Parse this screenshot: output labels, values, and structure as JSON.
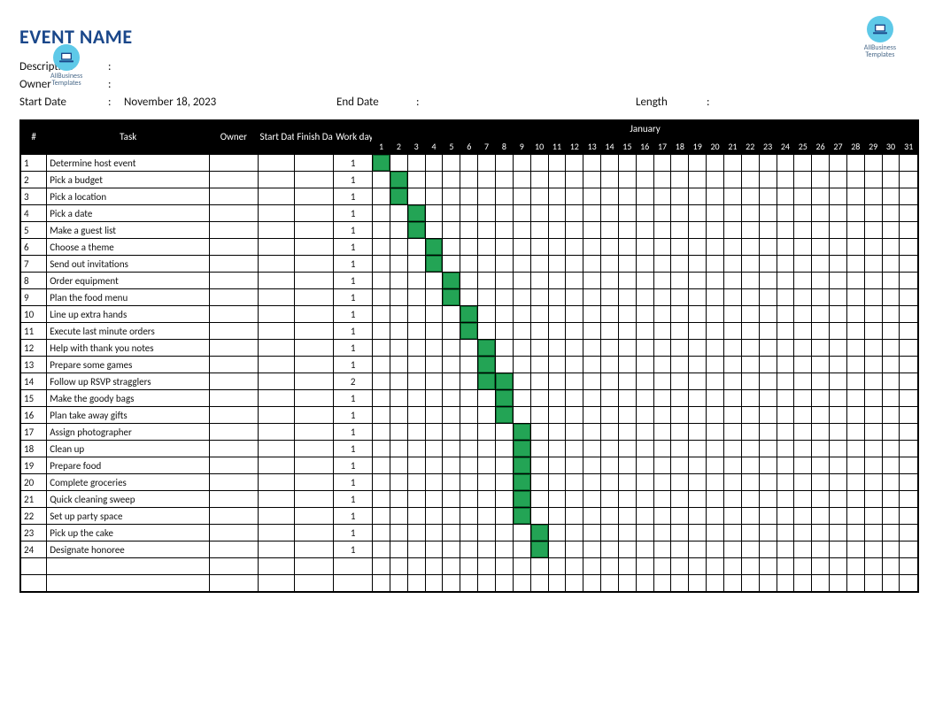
{
  "title": "EVENT NAME",
  "logo_text1": "AllBusiness",
  "logo_text2": "Templates",
  "meta": {
    "description_label": "Description",
    "description_value": "",
    "owner_label": "Owner",
    "owner_value": "",
    "startdate_label": "Start Date",
    "startdate_value": "November 18, 2023",
    "enddate_label": "End Date",
    "enddate_value": "",
    "length_label": "Length",
    "length_value": ""
  },
  "headers": {
    "num": "#",
    "task": "Task",
    "owner": "Owner",
    "start": "Start Date",
    "finish": "Finish Date",
    "work": "Work days",
    "month": "January"
  },
  "days": [
    1,
    2,
    3,
    4,
    5,
    6,
    7,
    8,
    9,
    10,
    11,
    12,
    13,
    14,
    15,
    16,
    17,
    18,
    19,
    20,
    21,
    22,
    23,
    24,
    25,
    26,
    27,
    28,
    29,
    30,
    31
  ],
  "chart_data": {
    "type": "gantt",
    "month": "January",
    "day_range": [
      1,
      31
    ],
    "rows": [
      {
        "num": 1,
        "task": "Determine host event",
        "owner": "",
        "start": "",
        "finish": "",
        "work_days": 1,
        "bar_start": 1,
        "bar_end": 1
      },
      {
        "num": 2,
        "task": "Pick a budget",
        "owner": "",
        "start": "",
        "finish": "",
        "work_days": 1,
        "bar_start": 2,
        "bar_end": 2
      },
      {
        "num": 3,
        "task": "Pick a location",
        "owner": "",
        "start": "",
        "finish": "",
        "work_days": 1,
        "bar_start": 2,
        "bar_end": 2
      },
      {
        "num": 4,
        "task": "Pick a date",
        "owner": "",
        "start": "",
        "finish": "",
        "work_days": 1,
        "bar_start": 3,
        "bar_end": 3
      },
      {
        "num": 5,
        "task": "Make a guest list",
        "owner": "",
        "start": "",
        "finish": "",
        "work_days": 1,
        "bar_start": 3,
        "bar_end": 3
      },
      {
        "num": 6,
        "task": "Choose a theme",
        "owner": "",
        "start": "",
        "finish": "",
        "work_days": 1,
        "bar_start": 4,
        "bar_end": 4
      },
      {
        "num": 7,
        "task": "Send out invitations",
        "owner": "",
        "start": "",
        "finish": "",
        "work_days": 1,
        "bar_start": 4,
        "bar_end": 4
      },
      {
        "num": 8,
        "task": "Order equipment",
        "owner": "",
        "start": "",
        "finish": "",
        "work_days": 1,
        "bar_start": 5,
        "bar_end": 5
      },
      {
        "num": 9,
        "task": "Plan the food menu",
        "owner": "",
        "start": "",
        "finish": "",
        "work_days": 1,
        "bar_start": 5,
        "bar_end": 5
      },
      {
        "num": 10,
        "task": "Line up extra hands",
        "owner": "",
        "start": "",
        "finish": "",
        "work_days": 1,
        "bar_start": 6,
        "bar_end": 6
      },
      {
        "num": 11,
        "task": "Execute last minute orders",
        "owner": "",
        "start": "",
        "finish": "",
        "work_days": 1,
        "bar_start": 6,
        "bar_end": 6
      },
      {
        "num": 12,
        "task": "Help with thank you notes",
        "owner": "",
        "start": "",
        "finish": "",
        "work_days": 1,
        "bar_start": 7,
        "bar_end": 7
      },
      {
        "num": 13,
        "task": "Prepare some games",
        "owner": "",
        "start": "",
        "finish": "",
        "work_days": 1,
        "bar_start": 7,
        "bar_end": 7
      },
      {
        "num": 14,
        "task": "Follow up RSVP stragglers",
        "owner": "",
        "start": "",
        "finish": "",
        "work_days": 2,
        "bar_start": 7,
        "bar_end": 8
      },
      {
        "num": 15,
        "task": "Make the goody bags",
        "owner": "",
        "start": "",
        "finish": "",
        "work_days": 1,
        "bar_start": 8,
        "bar_end": 8
      },
      {
        "num": 16,
        "task": "Plan take away gifts",
        "owner": "",
        "start": "",
        "finish": "",
        "work_days": 1,
        "bar_start": 8,
        "bar_end": 8
      },
      {
        "num": 17,
        "task": "Assign photographer",
        "owner": "",
        "start": "",
        "finish": "",
        "work_days": 1,
        "bar_start": 9,
        "bar_end": 9
      },
      {
        "num": 18,
        "task": "Clean up",
        "owner": "",
        "start": "",
        "finish": "",
        "work_days": 1,
        "bar_start": 9,
        "bar_end": 9
      },
      {
        "num": 19,
        "task": "Prepare food",
        "owner": "",
        "start": "",
        "finish": "",
        "work_days": 1,
        "bar_start": 9,
        "bar_end": 9
      },
      {
        "num": 20,
        "task": "Complete groceries",
        "owner": "",
        "start": "",
        "finish": "",
        "work_days": 1,
        "bar_start": 9,
        "bar_end": 9
      },
      {
        "num": 21,
        "task": "Quick cleaning sweep",
        "owner": "",
        "start": "",
        "finish": "",
        "work_days": 1,
        "bar_start": 9,
        "bar_end": 9
      },
      {
        "num": 22,
        "task": "Set up party space",
        "owner": "",
        "start": "",
        "finish": "",
        "work_days": 1,
        "bar_start": 9,
        "bar_end": 9
      },
      {
        "num": 23,
        "task": "Pick up the cake",
        "owner": "",
        "start": "",
        "finish": "",
        "work_days": 1,
        "bar_start": 10,
        "bar_end": 10
      },
      {
        "num": 24,
        "task": "Designate honoree",
        "owner": "",
        "start": "",
        "finish": "",
        "work_days": 1,
        "bar_start": 10,
        "bar_end": 10
      }
    ],
    "empty_rows": 2
  }
}
